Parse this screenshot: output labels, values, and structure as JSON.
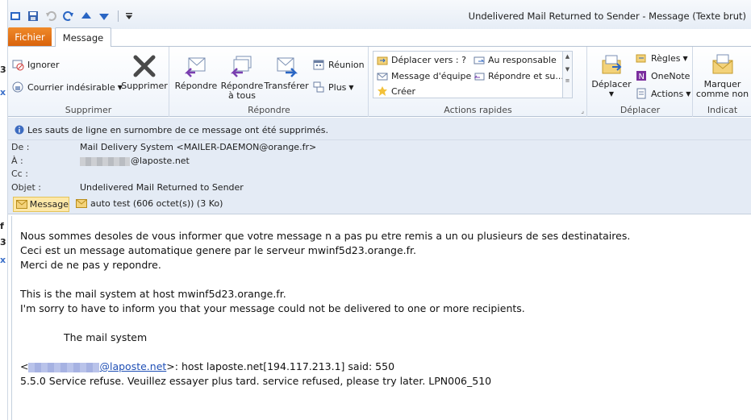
{
  "window": {
    "title": "Undelivered Mail Returned to Sender  -  Message (Texte brut)"
  },
  "tabs": {
    "file": "Fichier",
    "message": "Message"
  },
  "ribbon": {
    "groups": {
      "delete": {
        "label": "Supprimer",
        "ignore": "Ignorer",
        "junk": "Courrier indésirable",
        "delete": "Supprimer"
      },
      "respond": {
        "label": "Répondre",
        "reply": "Répondre",
        "reply_all_line1": "Répondre",
        "reply_all_line2": "à tous",
        "forward": "Transférer",
        "meeting": "Réunion",
        "more": "Plus"
      },
      "quick_steps": {
        "label": "Actions rapides",
        "items": [
          "Déplacer vers : ?",
          "Au responsable",
          "Message d'équipe",
          "Répondre et su...",
          "Créer"
        ]
      },
      "move": {
        "label": "Déplacer",
        "move": "Déplacer",
        "rules": "Règles",
        "onenote": "OneNote",
        "actions": "Actions"
      },
      "tags": {
        "label": "Indicat",
        "mark_line1": "Marquer",
        "mark_line2": "comme non"
      }
    }
  },
  "info_bar": {
    "text": "Les sauts de ligne en surnombre de ce message ont été supprimés."
  },
  "header": {
    "from_label": "De :",
    "from_value": "Mail Delivery System <MAILER-DAEMON@orange.fr>",
    "to_label": "À :",
    "to_domain": "@laposte.net",
    "cc_label": "Cc :",
    "cc_value": "",
    "subject_label": "Objet :",
    "subject_value": "Undelivered Mail Returned to Sender"
  },
  "attachments": {
    "message_tab": "Message",
    "file": "auto test (606 octet(s)) (3 Ko)"
  },
  "body": {
    "line1": "Nous sommes desoles de vous informer que votre message n a pas pu etre remis a un ou plusieurs de ses destinataires.",
    "line2": "Ceci est un message automatique genere par le serveur mwinf5d23.orange.fr.",
    "line3": "Merci de ne pas y repondre.",
    "line4": "This is the mail system at host mwinf5d23.orange.fr.",
    "line5": "I'm sorry to have to inform you that your message could not be delivered to one or more recipients.",
    "line6": "The mail system",
    "recipient_open": "<",
    "recipient_domain": "@laposte.net",
    "recipient_rest": ">: host laposte.net[194.117.213.1] said: 550",
    "line8": "5.5.0 Service refuse. Veuillez essayer plus tard. service refused, please try later. LPN006_510"
  },
  "colors": {
    "file_tab": "#e0701a",
    "header_bg": "#e4ebf5",
    "link": "#1f4fb5"
  }
}
